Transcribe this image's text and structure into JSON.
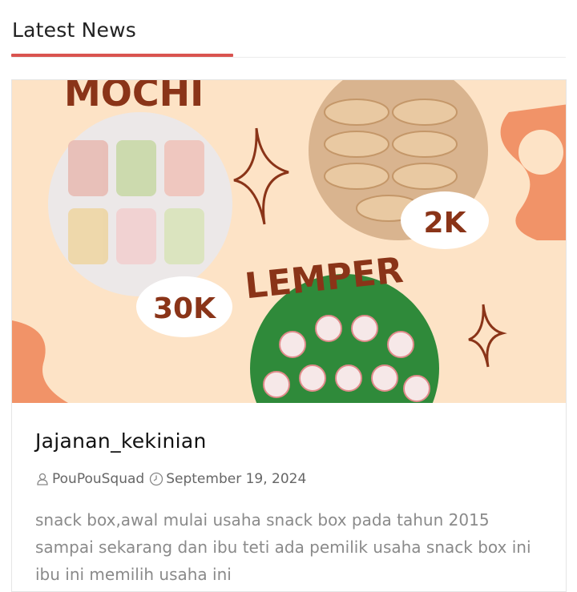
{
  "section": {
    "title": "Latest News"
  },
  "post": {
    "image": {
      "text_mochi": "MOCHI",
      "text_lemper": "LEMPER",
      "price_mochi": "30K",
      "price_pastry": "2K"
    },
    "title": "Jajanan_kekinian",
    "author": "PouPouSquad",
    "date": "September 19, 2024",
    "excerpt": "snack box,awal mulai usaha snack box pada tahun 2015 sampai sekarang dan ibu teti ada pemilik usaha snack box ini ibu ini memilih usaha ini"
  },
  "colors": {
    "accent": "#d9534f",
    "image_background": "#fde3c6",
    "image_text": "#8a3418",
    "image_shapes": "#f08a5d"
  },
  "icons": {
    "author": "user-icon",
    "date": "clock-icon"
  }
}
